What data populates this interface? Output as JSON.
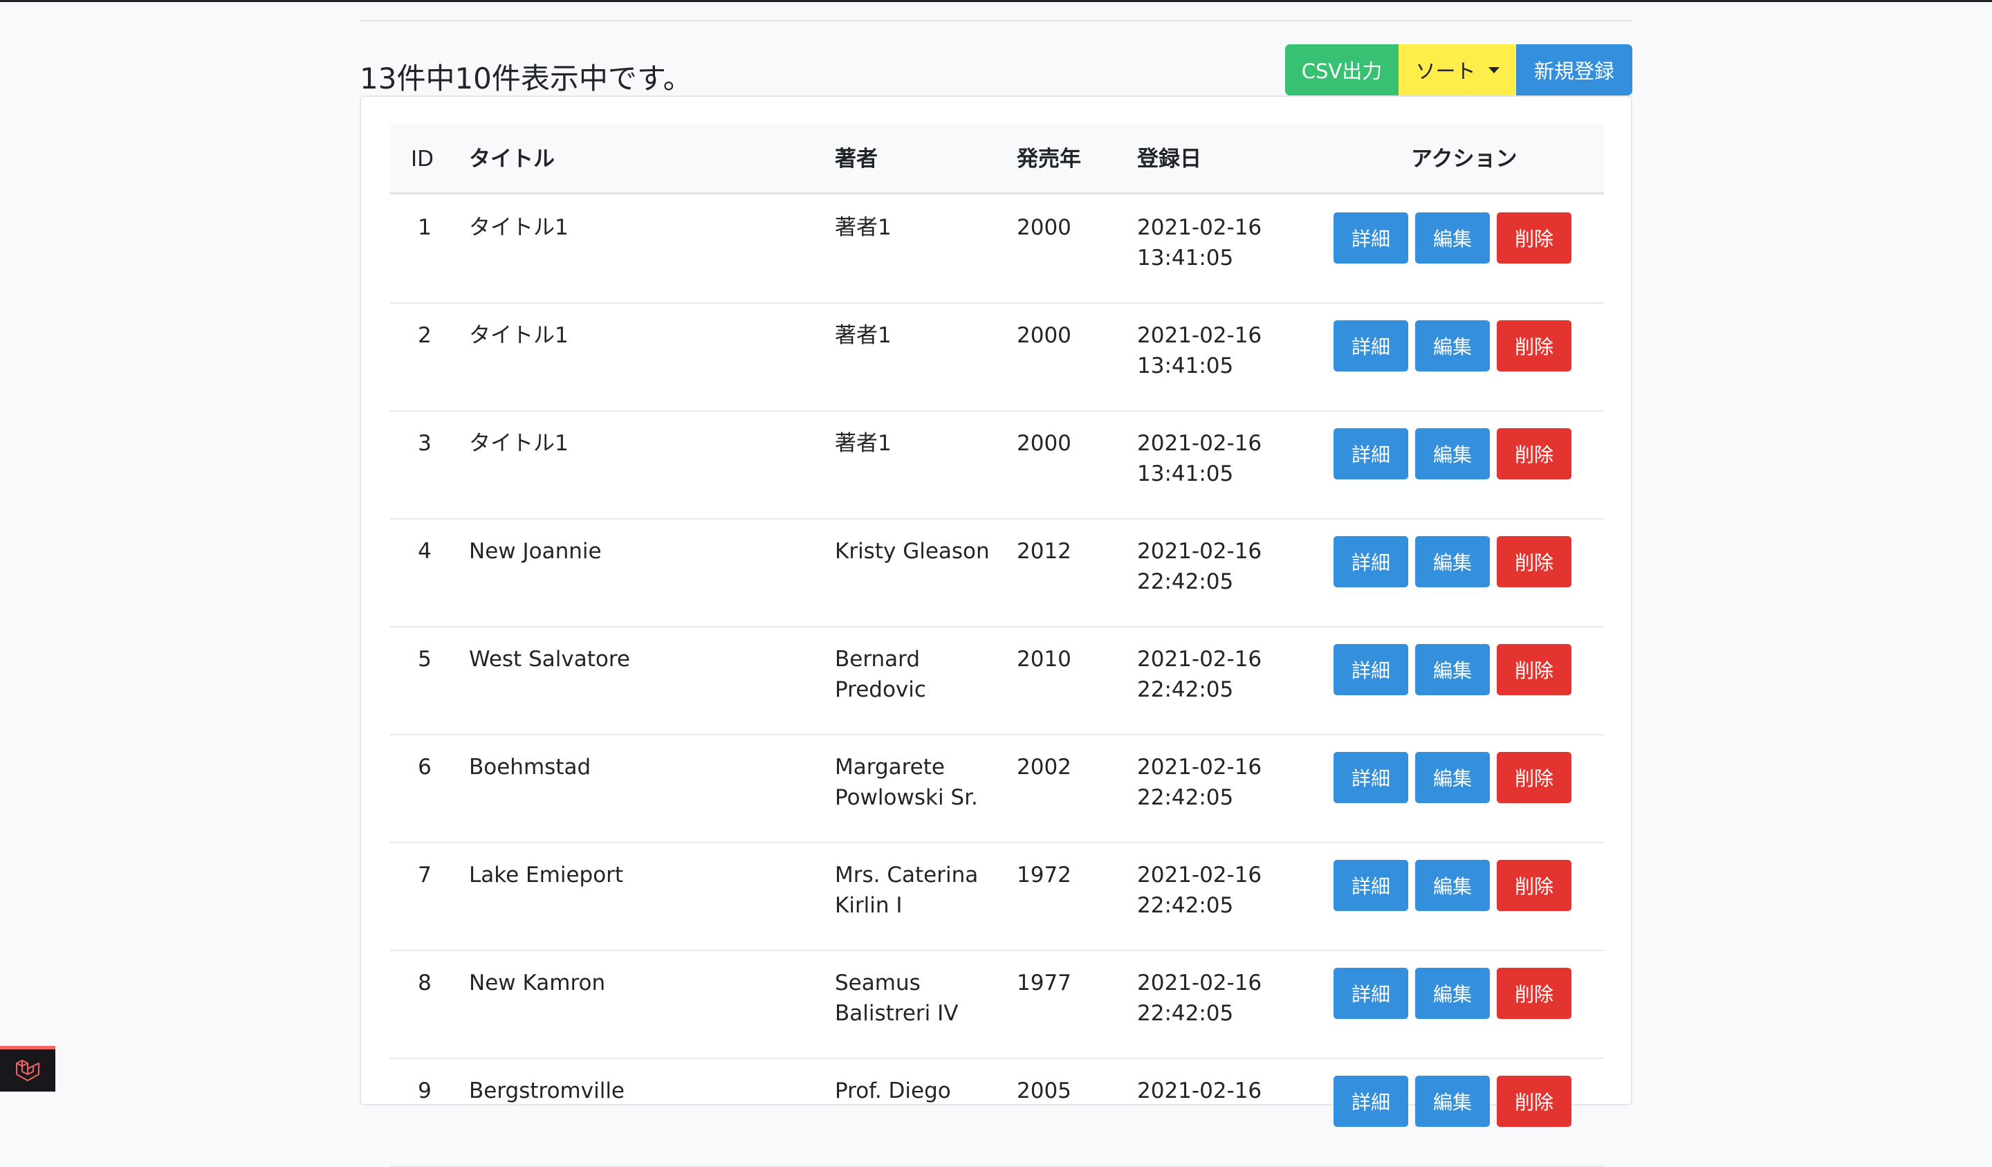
{
  "summary": "13件中10件表示中です。",
  "toolbar": {
    "csv_label": "CSV出力",
    "sort_label": "ソート",
    "new_label": "新規登録"
  },
  "columns": {
    "id": "ID",
    "title": "タイトル",
    "author": "著者",
    "year": "発売年",
    "date": "登録日",
    "actions": "アクション"
  },
  "actions": {
    "detail": "詳細",
    "edit": "編集",
    "delete": "削除"
  },
  "rows": [
    {
      "id": "1",
      "title": "タイトル1",
      "author": "著者1",
      "year": "2000",
      "date1": "2021-02-16",
      "date2": "13:41:05"
    },
    {
      "id": "2",
      "title": "タイトル1",
      "author": "著者1",
      "year": "2000",
      "date1": "2021-02-16",
      "date2": "13:41:05"
    },
    {
      "id": "3",
      "title": "タイトル1",
      "author": "著者1",
      "year": "2000",
      "date1": "2021-02-16",
      "date2": "13:41:05"
    },
    {
      "id": "4",
      "title": "New Joannie",
      "author": "Kristy Gleason",
      "year": "2012",
      "date1": "2021-02-16",
      "date2": "22:42:05"
    },
    {
      "id": "5",
      "title": "West Salvatore",
      "author": "Bernard Predovic",
      "year": "2010",
      "date1": "2021-02-16",
      "date2": "22:42:05"
    },
    {
      "id": "6",
      "title": "Boehmstad",
      "author": "Margarete Powlowski Sr.",
      "year": "2002",
      "date1": "2021-02-16",
      "date2": "22:42:05"
    },
    {
      "id": "7",
      "title": "Lake Emieport",
      "author": "Mrs. Caterina Kirlin I",
      "year": "1972",
      "date1": "2021-02-16",
      "date2": "22:42:05"
    },
    {
      "id": "8",
      "title": "New Kamron",
      "author": "Seamus Balistreri IV",
      "year": "1977",
      "date1": "2021-02-16",
      "date2": "22:42:05"
    },
    {
      "id": "9",
      "title": "Bergstromville",
      "author": "Prof. Diego",
      "year": "2005",
      "date1": "2021-02-16",
      "date2": ""
    }
  ],
  "icons": {
    "debugbar": "laravel-logo-icon"
  }
}
